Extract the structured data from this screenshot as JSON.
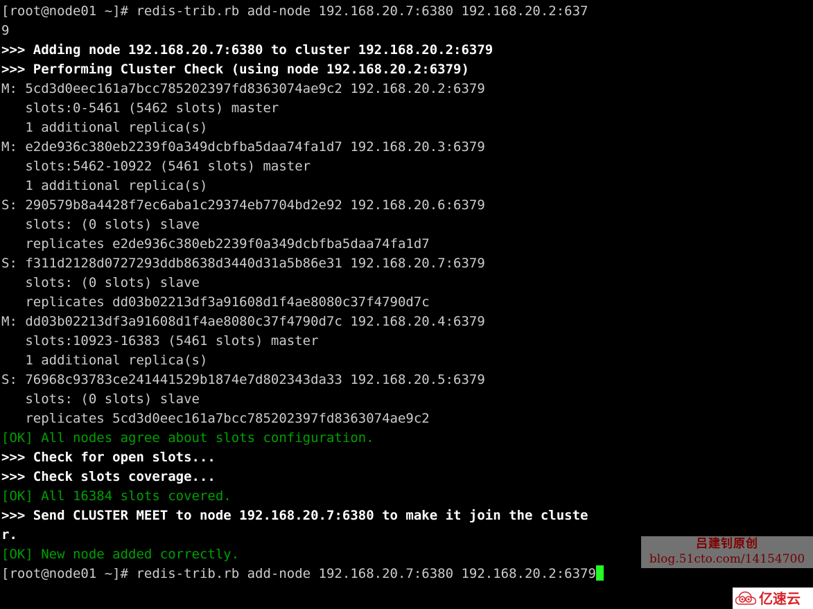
{
  "terminal": {
    "prompt": "[root@node01 ~]#",
    "cursor_glyph": "block-cursor",
    "colors": {
      "background": "#000000",
      "foreground": "#cccccc",
      "bright": "#ffffff",
      "green": "#00a000",
      "cursor": "#24fc24"
    },
    "lines": [
      {
        "text": "[root@node01 ~]# redis-trib.rb add-node 192.168.20.7:6380 192.168.20.2:637",
        "style": "default"
      },
      {
        "text": "9",
        "style": "default"
      },
      {
        "text": ">>> Adding node 192.168.20.7:6380 to cluster 192.168.20.2:6379",
        "style": "bright"
      },
      {
        "text": ">>> Performing Cluster Check (using node 192.168.20.2:6379)",
        "style": "bright"
      },
      {
        "text": "M: 5cd3d0eec161a7bcc785202397fd8363074ae9c2 192.168.20.2:6379",
        "style": "default"
      },
      {
        "text": "   slots:0-5461 (5462 slots) master",
        "style": "default"
      },
      {
        "text": "   1 additional replica(s)",
        "style": "default"
      },
      {
        "text": "M: e2de936c380eb2239f0a349dcbfba5daa74fa1d7 192.168.20.3:6379",
        "style": "default"
      },
      {
        "text": "   slots:5462-10922 (5461 slots) master",
        "style": "default"
      },
      {
        "text": "   1 additional replica(s)",
        "style": "default"
      },
      {
        "text": "S: 290579b8a4428f7ec6aba1c29374eb7704bd2e92 192.168.20.6:6379",
        "style": "default"
      },
      {
        "text": "   slots: (0 slots) slave",
        "style": "default"
      },
      {
        "text": "   replicates e2de936c380eb2239f0a349dcbfba5daa74fa1d7",
        "style": "default"
      },
      {
        "text": "S: f311d2128d0727293ddb8638d3440d31a5b86e31 192.168.20.7:6379",
        "style": "default"
      },
      {
        "text": "   slots: (0 slots) slave",
        "style": "default"
      },
      {
        "text": "   replicates dd03b02213df3a91608d1f4ae8080c37f4790d7c",
        "style": "default"
      },
      {
        "text": "M: dd03b02213df3a91608d1f4ae8080c37f4790d7c 192.168.20.4:6379",
        "style": "default"
      },
      {
        "text": "   slots:10923-16383 (5461 slots) master",
        "style": "default"
      },
      {
        "text": "   1 additional replica(s)",
        "style": "default"
      },
      {
        "text": "S: 76968c93783ce241441529b1874e7d802343da33 192.168.20.5:6379",
        "style": "default"
      },
      {
        "text": "   slots: (0 slots) slave",
        "style": "default"
      },
      {
        "text": "   replicates 5cd3d0eec161a7bcc785202397fd8363074ae9c2",
        "style": "default"
      },
      {
        "text": "[OK] All nodes agree about slots configuration.",
        "style": "green"
      },
      {
        "text": ">>> Check for open slots...",
        "style": "bright"
      },
      {
        "text": ">>> Check slots coverage...",
        "style": "bright"
      },
      {
        "text": "[OK] All 16384 slots covered.",
        "style": "green"
      },
      {
        "text": ">>> Send CLUSTER MEET to node 192.168.20.7:6380 to make it join the cluste",
        "style": "bright"
      },
      {
        "text": "r.",
        "style": "bright"
      },
      {
        "text": "[OK] New node added correctly.",
        "style": "green"
      },
      {
        "text": "[root@node01 ~]# redis-trib.rb add-node 192.168.20.7:6380 192.168.20.2:6379",
        "style": "default",
        "cursor": true
      }
    ]
  },
  "watermark": {
    "line1": "吕建钊原创",
    "line2": "blog.51cto.com/14154700",
    "text_color": "#8a0000",
    "box_color": "#7c7c7c"
  },
  "corner_logo": {
    "text": "亿速云",
    "mark": "cloud-spiral-icon",
    "color": "#d8232a"
  }
}
